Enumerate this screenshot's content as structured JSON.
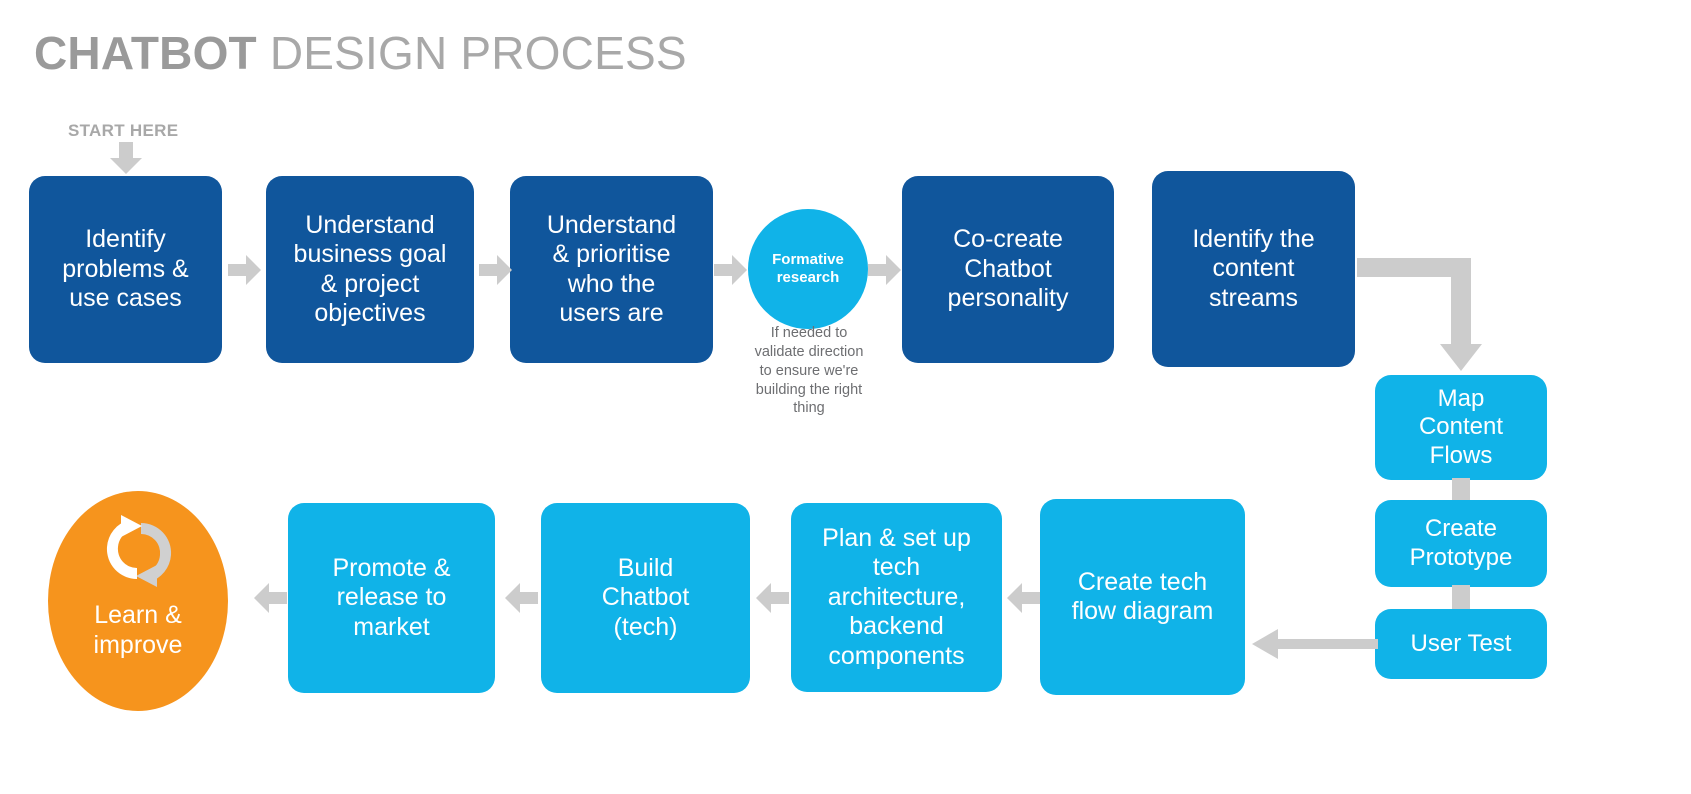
{
  "title": {
    "bold": "CHATBOT",
    "light": " DESIGN PROCESS"
  },
  "start": {
    "label": "START HERE",
    "arrow_icon": "arrow-down-icon"
  },
  "colors": {
    "dark_blue": "#10569c",
    "light_blue": "#10b3e8",
    "orange": "#f6941d",
    "arrow_grey": "#cccccc",
    "title_grey": "#9a9a9a",
    "caption_grey": "#6d6e71"
  },
  "chart_data": {
    "type": "diagram",
    "title": "CHATBOT DESIGN PROCESS",
    "flow": [
      "Identify problems  & use cases",
      "Understand business goal & project objectives",
      "Understand & prioritise who the users are",
      "Formative research",
      "Co-create Chatbot personality",
      "Identify the content streams",
      "Map Content Flows",
      "Create Prototype",
      "User Test",
      "Create tech flow diagram",
      "Plan & set up tech architecture, backend components",
      "Build Chatbot (tech)",
      "Promote & release to market",
      "Learn & improve"
    ]
  },
  "row1": {
    "nodes": [
      {
        "id": "identify-problems",
        "lines": [
          "Identify",
          "problems  &",
          "use cases"
        ]
      },
      {
        "id": "understand-business",
        "lines": [
          "Understand",
          "business goal",
          "& project",
          "objectives"
        ]
      },
      {
        "id": "understand-users",
        "lines": [
          "Understand",
          "& prioritise",
          "who the",
          "users are"
        ]
      },
      {
        "id": "co-create-personality",
        "lines": [
          "Co-create",
          "Chatbot",
          "personality"
        ]
      },
      {
        "id": "identify-content",
        "lines": [
          "Identify the",
          "content",
          "streams"
        ]
      }
    ]
  },
  "formative": {
    "lines": [
      "Formative",
      "research"
    ],
    "caption": [
      "If needed to",
      "validate direction",
      "to ensure we're",
      "building the right",
      "thing"
    ]
  },
  "right_column": {
    "nodes": [
      {
        "id": "map-content-flows",
        "lines": [
          "Map",
          "Content",
          "Flows"
        ]
      },
      {
        "id": "create-prototype",
        "lines": [
          "Create",
          "Prototype"
        ]
      },
      {
        "id": "user-test",
        "lines": [
          "User Test"
        ]
      }
    ]
  },
  "row2": {
    "nodes": [
      {
        "id": "create-tech-flow",
        "lines": [
          "Create tech",
          "flow diagram"
        ]
      },
      {
        "id": "plan-tech-arch",
        "lines": [
          "Plan & set up",
          "tech",
          "architecture,",
          "backend",
          "components"
        ]
      },
      {
        "id": "build-chatbot",
        "lines": [
          "Build",
          "Chatbot",
          "(tech)"
        ]
      },
      {
        "id": "promote-release",
        "lines": [
          "Promote &",
          "release to",
          "market"
        ]
      }
    ]
  },
  "learn_improve": {
    "lines": [
      "Learn &",
      "improve"
    ],
    "icon": "cycle-refresh-icon"
  }
}
